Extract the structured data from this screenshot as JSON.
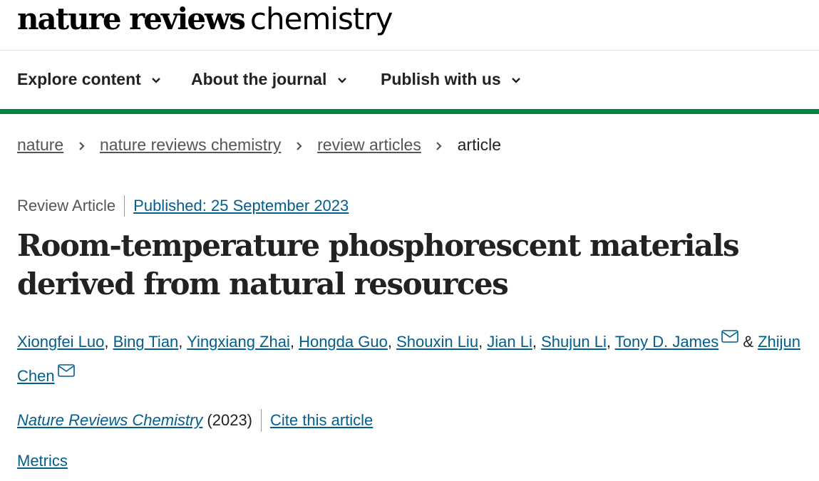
{
  "header": {
    "brand": "nature reviews",
    "journal": "chemistry"
  },
  "nav": {
    "items": [
      {
        "label": "Explore content"
      },
      {
        "label": "About the journal"
      },
      {
        "label": "Publish with us"
      }
    ]
  },
  "breadcrumb": {
    "items": [
      "nature",
      "nature reviews chemistry",
      "review articles"
    ],
    "current": "article"
  },
  "article": {
    "type": "Review Article",
    "published": "Published: 25 September 2023",
    "title": "Room-temperature phosphorescent materials derived from natural resources",
    "authors": [
      "Xiongfei Luo",
      "Bing Tian",
      "Yingxiang Zhai",
      "Hongda Guo",
      "Shouxin Liu",
      "Jian Li",
      "Shujun Li",
      "Tony D. James",
      "Zhijun Chen"
    ],
    "journal_name": "Nature Reviews Chemistry",
    "year": "(2023)",
    "cite_label": "Cite this article",
    "metrics_label": "Metrics"
  },
  "colors": {
    "link": "#025e8d",
    "nav_border": "#00833e"
  },
  "icons": {
    "nav_chevron": "chevron-down-icon",
    "breadcrumb_sep": "chevron-right-icon",
    "mail": "mail-icon"
  }
}
